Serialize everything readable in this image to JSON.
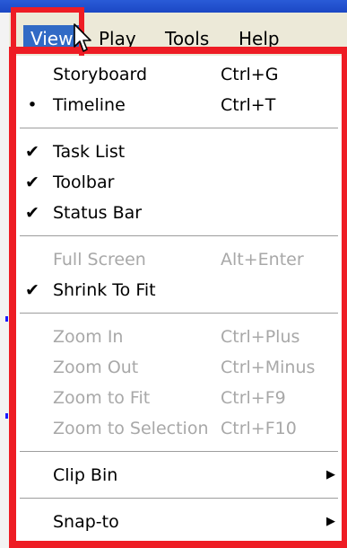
{
  "menubar": {
    "items": [
      {
        "label": "View",
        "active": true
      },
      {
        "label": "Play",
        "active": false
      },
      {
        "label": "Tools",
        "active": false
      },
      {
        "label": "Help",
        "active": false
      }
    ]
  },
  "view_menu": {
    "items": [
      {
        "label": "Storyboard",
        "shortcut": "Ctrl+G",
        "mark": "",
        "enabled": true
      },
      {
        "label": "Timeline",
        "shortcut": "Ctrl+T",
        "mark": "•",
        "enabled": true
      },
      {
        "label": "Task List",
        "shortcut": "",
        "mark": "✔",
        "enabled": true
      },
      {
        "label": "Toolbar",
        "shortcut": "",
        "mark": "✔",
        "enabled": true
      },
      {
        "label": "Status Bar",
        "shortcut": "",
        "mark": "✔",
        "enabled": true
      },
      {
        "label": "Full Screen",
        "shortcut": "Alt+Enter",
        "mark": "",
        "enabled": false
      },
      {
        "label": "Shrink To Fit",
        "shortcut": "",
        "mark": "✔",
        "enabled": true
      },
      {
        "label": "Zoom In",
        "shortcut": "Ctrl+Plus",
        "mark": "",
        "enabled": false
      },
      {
        "label": "Zoom Out",
        "shortcut": "Ctrl+Minus",
        "mark": "",
        "enabled": false
      },
      {
        "label": "Zoom to Fit",
        "shortcut": "Ctrl+F9",
        "mark": "",
        "enabled": false
      },
      {
        "label": "Zoom to Selection",
        "shortcut": "Ctrl+F10",
        "mark": "",
        "enabled": false
      },
      {
        "label": "Clip Bin",
        "shortcut": "",
        "mark": "",
        "enabled": true,
        "submenu_arrow": "▶"
      },
      {
        "label": "Snap-to",
        "shortcut": "",
        "mark": "",
        "enabled": true,
        "submenu_arrow": "▶"
      }
    ]
  },
  "colors": {
    "highlight": "#316ac5",
    "annotation_red": "#ee1c24",
    "disabled_text": "#a8a8a8"
  }
}
